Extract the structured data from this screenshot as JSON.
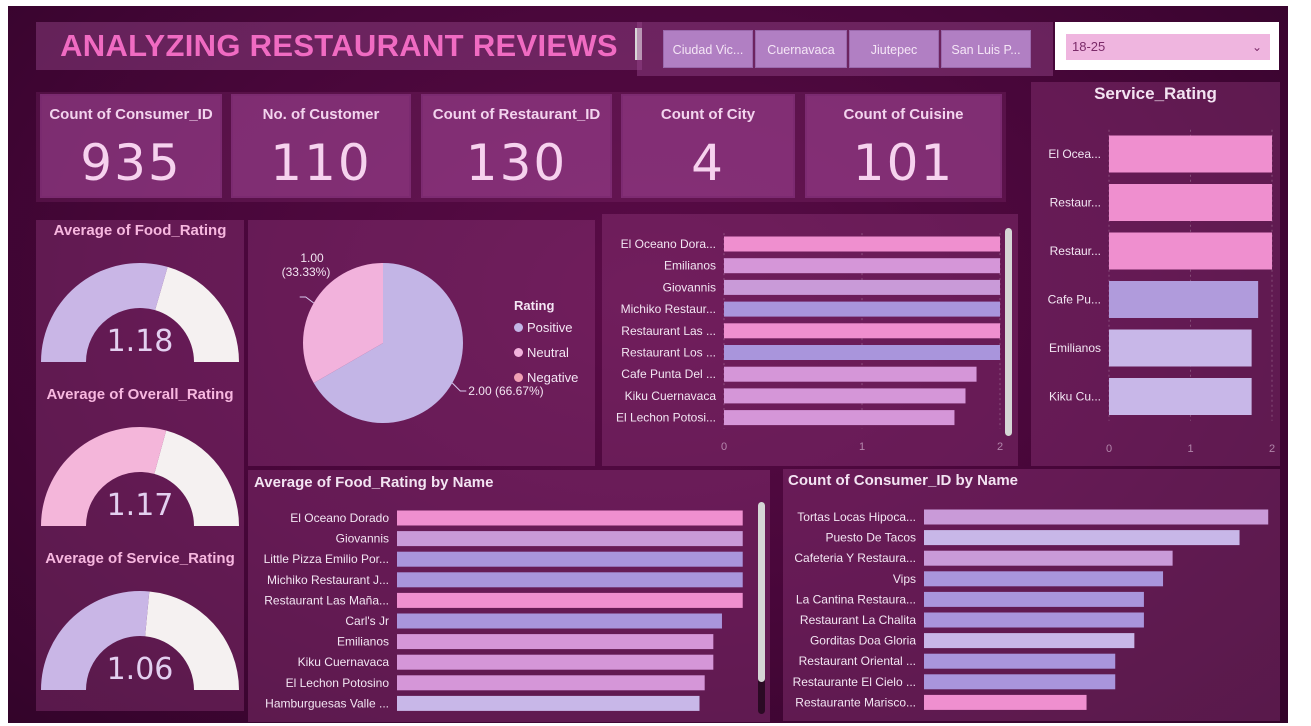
{
  "title": "ANALYZING RESTAURANT REVIEWS",
  "city_slicer": [
    "Ciudad Vic...",
    "Cuernavaca",
    "Jiutepec",
    "San Luis P..."
  ],
  "age_dropdown": {
    "value": "18-25"
  },
  "kpis": [
    {
      "label": "Count of Consumer_ID",
      "value": "935"
    },
    {
      "label": "No. of Customer",
      "value": "110"
    },
    {
      "label": "Count of Restaurant_ID",
      "value": "130"
    },
    {
      "label": "Count of City",
      "value": "4"
    },
    {
      "label": "Count of Cuisine",
      "value": "101"
    }
  ],
  "gauges": [
    {
      "title": "Average of Food_Rating",
      "display": "1.18",
      "value": 1.18,
      "max": 2,
      "color": "#c9b6e6"
    },
    {
      "title": "Average of Overall_Rating",
      "display": "1.17",
      "value": 1.17,
      "max": 2,
      "color": "#f4b6da"
    },
    {
      "title": "Average of Service_Rating",
      "display": "1.06",
      "value": 1.06,
      "max": 2,
      "color": "#c9b6e6"
    }
  ],
  "colors": {
    "accent_title": "#f06bc2",
    "positive": "#c3b5e6",
    "neutral": "#f2b2dc",
    "negative": "#f0a0b4",
    "gauge_track": "#f5f1f1"
  },
  "chart_data": [
    {
      "type": "pie",
      "legend_title": "Rating",
      "legend": [
        "Positive",
        "Neutral",
        "Negative"
      ],
      "slices": [
        {
          "value": 2.0,
          "label": "2.00 (66.67%)",
          "color": "#c3b5e6"
        },
        {
          "value": 1.0,
          "label_top": "1.00",
          "label_bottom": "(33.33%)",
          "color": "#f2b2dc"
        }
      ]
    },
    {
      "type": "bar",
      "id": "top_right_bars",
      "categories": [
        "El Oceano Dora...",
        "Emilianos",
        "Giovannis",
        "Michiko Restaur...",
        "Restaurant Las ...",
        "Restaurant Los ...",
        "Cafe Punta Del ...",
        "Kiku Cuernavaca",
        "El Lechon Potosi..."
      ],
      "values": [
        2.0,
        2.0,
        2.0,
        2.0,
        2.0,
        2.0,
        1.83,
        1.75,
        1.67
      ],
      "colors": [
        "#ef8fcf",
        "#d596d8",
        "#c99ad8",
        "#a995dc",
        "#ef8fcf",
        "#a995dc",
        "#d596d8",
        "#d596d8",
        "#d596d8"
      ],
      "xlim": [
        0,
        2
      ],
      "xticks": [
        "0",
        "1",
        "2"
      ]
    },
    {
      "type": "bar",
      "id": "service_rating",
      "title": "Service_Rating",
      "categories": [
        "El Ocea...",
        "Restaur...",
        "Restaur...",
        "Cafe Pu...",
        "Emilianos",
        "Kiku Cu..."
      ],
      "values": [
        2.0,
        2.0,
        2.0,
        1.83,
        1.75,
        1.75
      ],
      "colors": [
        "#ef8fcf",
        "#ef8fcf",
        "#ef8fcf",
        "#b09bdc",
        "#c8b7e8",
        "#c8b7e8"
      ],
      "xlim": [
        0,
        2
      ],
      "xticks": [
        "0",
        "1",
        "2"
      ]
    },
    {
      "type": "bar",
      "id": "food_by_name",
      "title": "Average of Food_Rating by Name",
      "categories": [
        "El Oceano Dorado",
        "Giovannis",
        "Little Pizza Emilio Por...",
        "Michiko Restaurant J...",
        "Restaurant Las Maña...",
        "Carl's Jr",
        "Emilianos",
        "Kiku Cuernavaca",
        "El Lechon Potosino",
        "Hamburguesas Valle ..."
      ],
      "values": [
        2.0,
        2.0,
        2.0,
        2.0,
        2.0,
        1.88,
        1.83,
        1.83,
        1.78,
        1.75
      ],
      "colors": [
        "#ef8fcf",
        "#c99ad8",
        "#a995dc",
        "#a995dc",
        "#ef8fcf",
        "#a995dc",
        "#d596d8",
        "#d596d8",
        "#d596d8",
        "#c8b7e8"
      ],
      "xlim": [
        0,
        2.1
      ]
    },
    {
      "type": "bar",
      "id": "consumer_by_name",
      "title": "Count of Consumer_ID by Name",
      "categories": [
        "Tortas Locas Hipoca...",
        "Puesto De Tacos",
        "Cafeteria Y Restaura...",
        "Vips",
        "La Cantina Restaura...",
        "Restaurant La Chalita",
        "Gorditas Doa Gloria",
        "Restaurant Oriental ...",
        "Restaurante El Cielo ...",
        "Restaurante Marisco..."
      ],
      "values": [
        36,
        33,
        26,
        25,
        23,
        23,
        22,
        20,
        20,
        17
      ],
      "colors": [
        "#c99ad8",
        "#c8b7e8",
        "#c99ad8",
        "#a995dc",
        "#a995dc",
        "#a995dc",
        "#c8b7e8",
        "#a995dc",
        "#a995dc",
        "#ef8fcf"
      ],
      "xlim": [
        0,
        36.5
      ]
    }
  ]
}
